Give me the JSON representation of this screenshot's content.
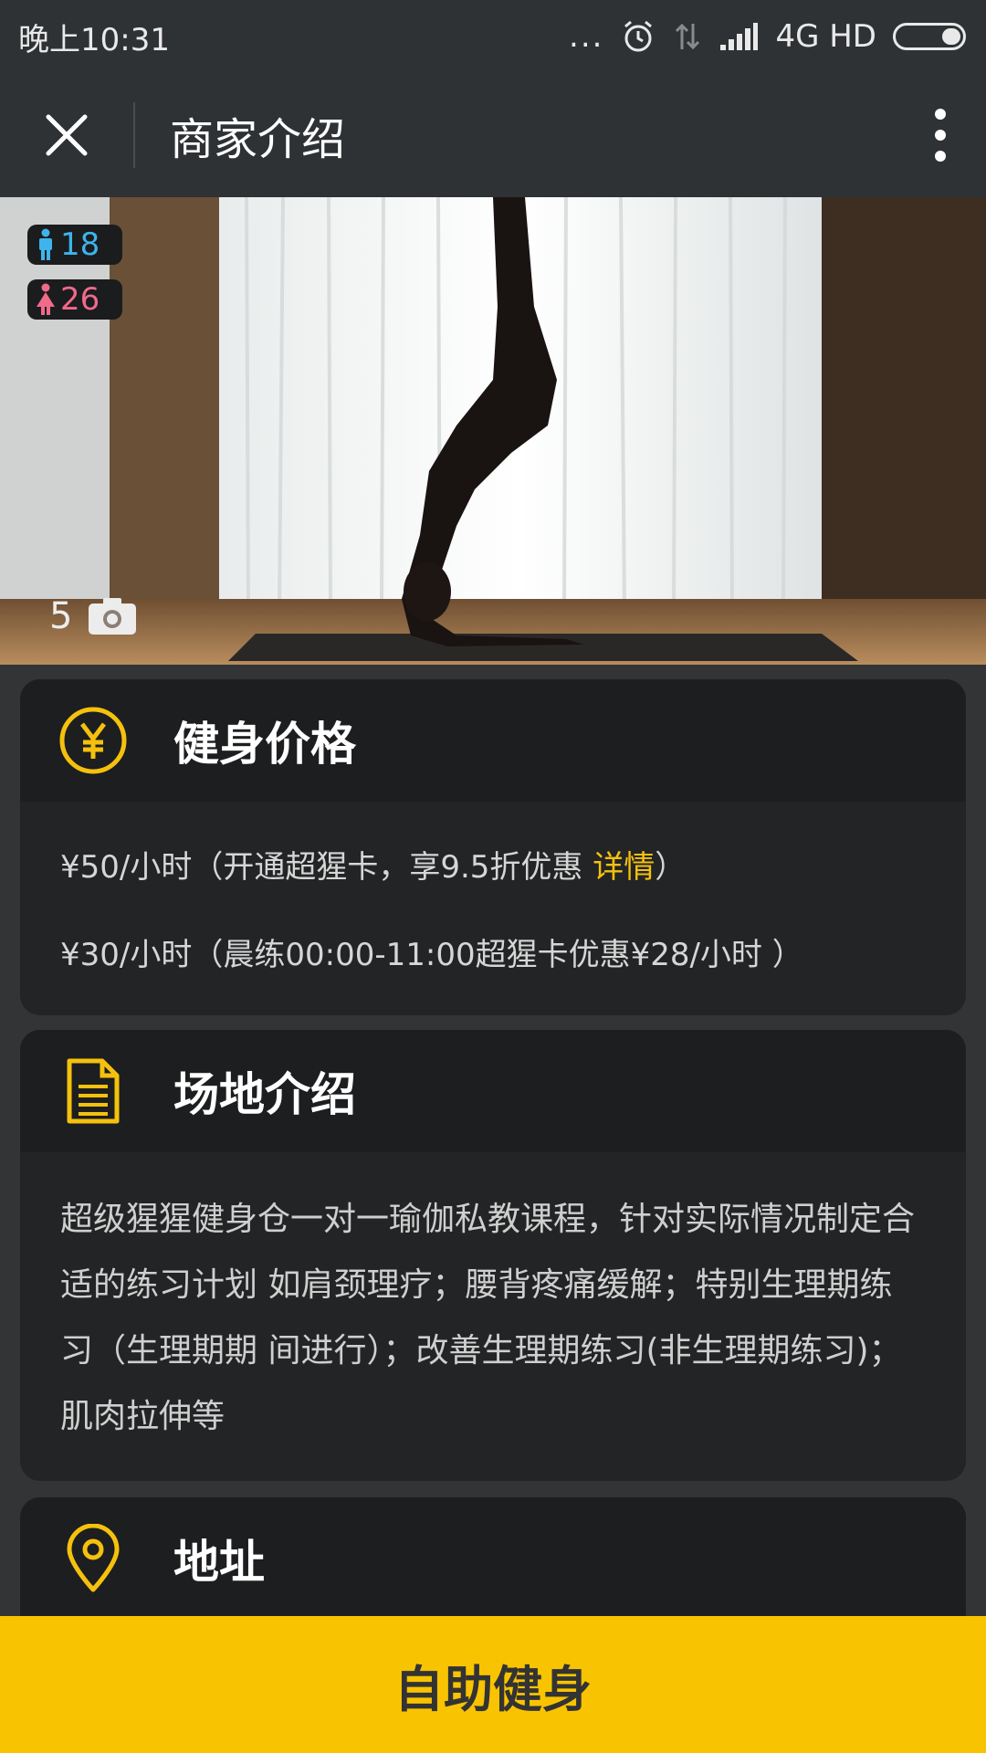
{
  "status_bar": {
    "time": "晚上10:31",
    "dots": "...",
    "network": "4G HD"
  },
  "nav": {
    "title": "商家介绍"
  },
  "hero": {
    "male_count": "18",
    "female_count": "26",
    "photo_count": "5"
  },
  "price_card": {
    "title": "健身价格",
    "line1_text": "¥50/小时（开通超猩卡，享9.5折优惠 ",
    "line1_link": "详情",
    "line1_end": "）",
    "line2_text": "¥30/小时（晨练00:00-11:00超猩卡优惠¥28/小时 ）"
  },
  "venue_card": {
    "title": "场地介绍",
    "description": "超级猩猩健身仓一对一瑜伽私教课程，针对实际情况制定合适的练习计划 如肩颈理疗；腰背疼痛缓解；特别生理期练习（生理期期 间进行）；改善生理期练习(非生理期练习)；肌肉拉伸等"
  },
  "address_card": {
    "title": "地址"
  },
  "bottom_button": {
    "label": "自助健身"
  },
  "colors": {
    "accent": "#f8c300",
    "link": "#f5c10d",
    "male": "#3fb3ec",
    "female": "#f06a8a"
  }
}
